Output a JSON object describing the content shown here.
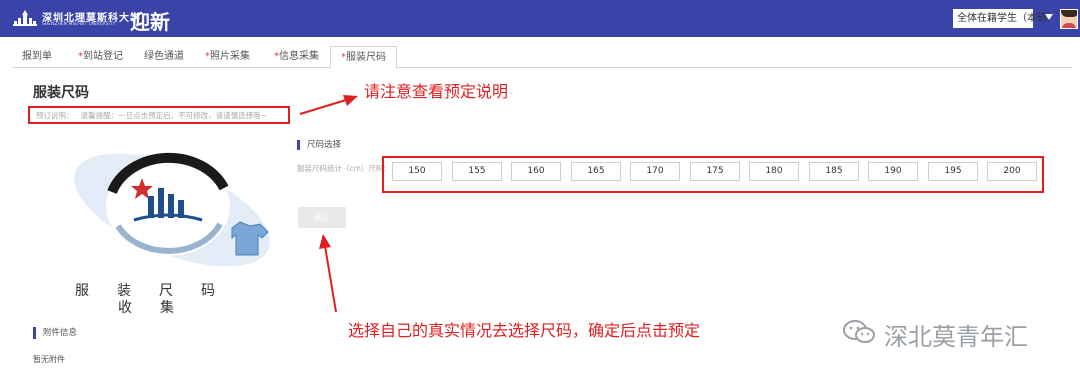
{
  "header": {
    "university_name": "深圳北理莫斯科大学",
    "university_sub": "SHENZHEN MSU-BIT UNIVERSITY",
    "app_title": "迎新",
    "role_selector": "全体在籍学生（本研）"
  },
  "tabs": [
    {
      "label": "报到单",
      "required": false,
      "active": false
    },
    {
      "label": "到站登记",
      "required": true,
      "active": false
    },
    {
      "label": "绿色通道",
      "required": false,
      "active": false
    },
    {
      "label": "照片采集",
      "required": true,
      "active": false
    },
    {
      "label": "信息采集",
      "required": true,
      "active": false
    },
    {
      "label": "服装尺码",
      "required": true,
      "active": true
    }
  ],
  "page": {
    "title": "服装尺码",
    "notice_label": "预订说明：",
    "notice_text": "温馨提醒：一旦点击预定后，不可修改，请谨慎选择哦~"
  },
  "callouts": {
    "top": "请注意查看预定说明",
    "bottom": "选择自己的真实情况去选择尺码，确定后点击预定"
  },
  "size_section": {
    "heading": "尺码选择",
    "field_label": "服装尺码统计（cm）尺码:",
    "sizes": [
      "150",
      "155",
      "160",
      "165",
      "170",
      "175",
      "180",
      "185",
      "190",
      "195",
      "200"
    ],
    "reserve_button": "预订"
  },
  "image_caption": {
    "line1": "服装尺码",
    "line2": "收集"
  },
  "attachments": {
    "heading": "附件信息",
    "empty_text": "暂无附件"
  },
  "watermark": "深北莫青年汇",
  "colors": {
    "header_bg": "#3a43a8",
    "highlight_red": "#e02020",
    "required_star": "#e23b3b"
  }
}
